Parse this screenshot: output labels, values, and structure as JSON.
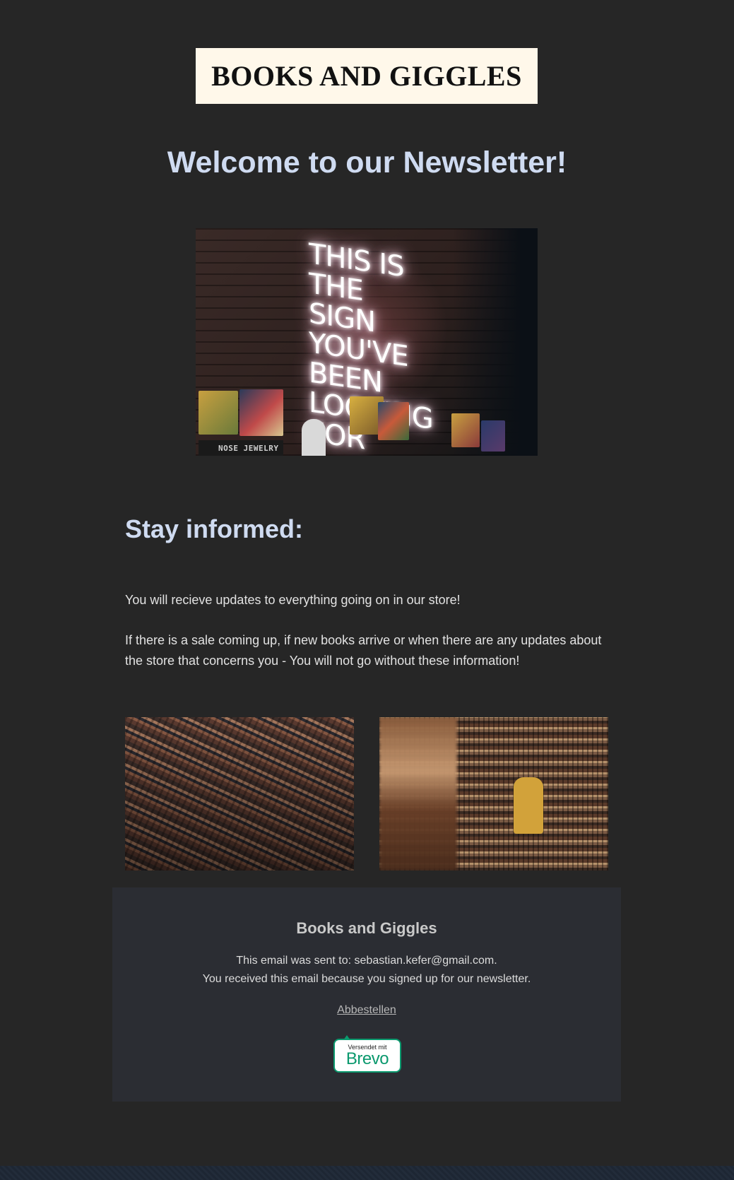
{
  "header": {
    "logo_text": "BOOKS AND GIGGLES"
  },
  "main": {
    "title": "Welcome to our Newsletter!",
    "hero_sign_text": "THIS IS\nTHE SIGN\nYOU'VE BEEN\nLOOKING FOR",
    "hero_shelf_sign": "NOSE JEWELRY",
    "subtitle": "Stay informed:",
    "paragraph_1": "You will recieve updates to everything going on in our store!",
    "paragraph_2": "If there is a sale coming up, if new books arrive or when there are any updates about the store that concerns you - You will not go without these information!"
  },
  "footer": {
    "brand": "Books and Giggles",
    "sent_to_line": "This email was sent to:  sebastian.kefer@gmail.com.",
    "reason_line": "You received this email because you signed up for our newsletter.",
    "unsubscribe_label": "Abbestellen",
    "badge_small": "Versendet mit",
    "badge_big": "Brevo"
  },
  "colors": {
    "background": "#262626",
    "heading": "#cfdbf1",
    "footer_bg": "#2b2d33",
    "brevo_green": "#0b996e",
    "logo_bg": "#fff8ea"
  }
}
